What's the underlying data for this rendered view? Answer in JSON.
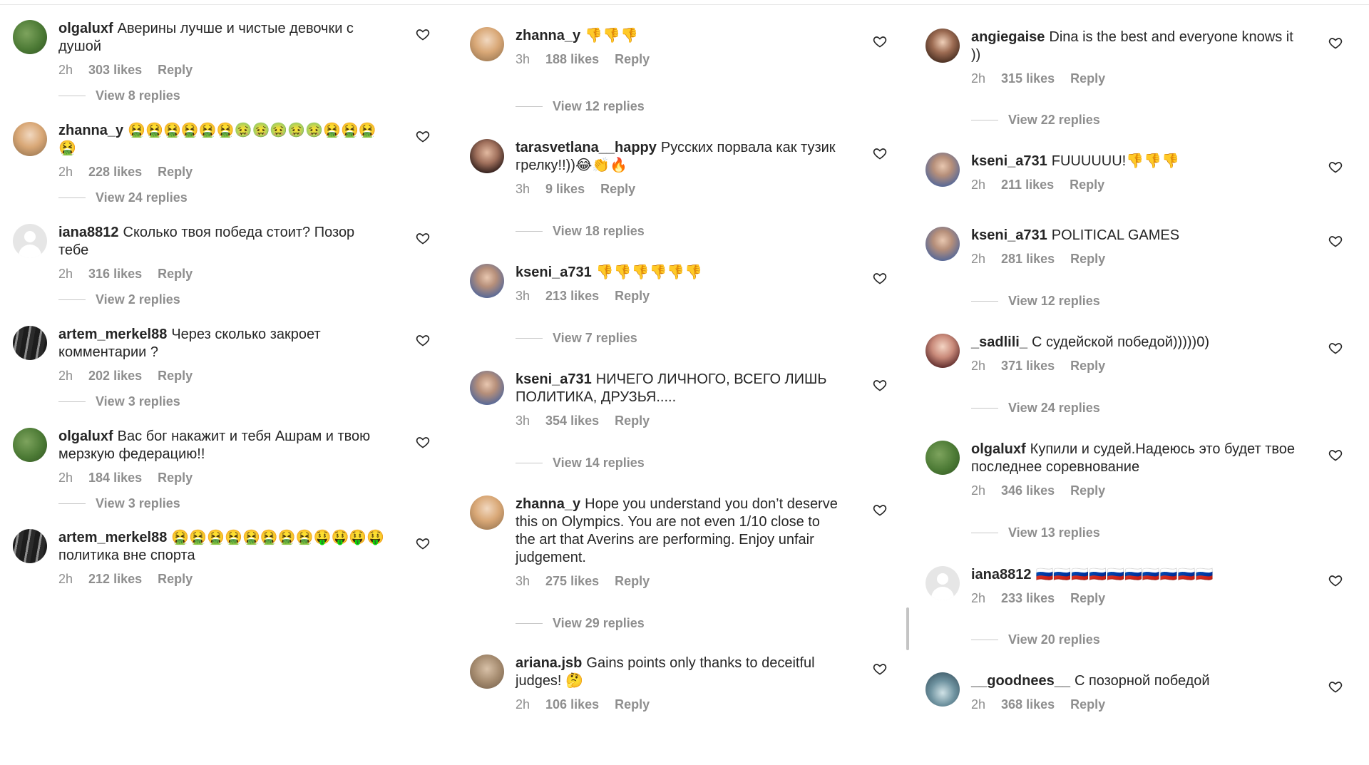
{
  "columns": [
    {
      "comments": [
        {
          "username": "olgaluxf",
          "text": "Аверины лучше и чистые девочки с душой",
          "time": "2h",
          "likes": "303 likes",
          "reply": "Reply",
          "view_replies": "View 8 replies",
          "avatar": "green"
        },
        {
          "username": "zhanna_y",
          "text": "🤮🤮🤮🤮🤮🤮🤢🤢🤢🤢🤢🤮🤮🤮🤮",
          "time": "2h",
          "likes": "228 likes",
          "reply": "Reply",
          "view_replies": "View 24 replies",
          "avatar": "blonde"
        },
        {
          "username": "iana8812",
          "text": "Сколько твоя победа стоит? Позор тебе",
          "time": "2h",
          "likes": "316 likes",
          "reply": "Reply",
          "view_replies": "View 2 replies",
          "avatar": "grey"
        },
        {
          "username": "artem_merkel88",
          "text": "Через сколько закроет комментарии ?",
          "time": "2h",
          "likes": "202 likes",
          "reply": "Reply",
          "view_replies": "View 3 replies",
          "avatar": "dark"
        },
        {
          "username": "olgaluxf",
          "text": "Вас бог накажит и тебя Ашрам и твою мерзкую федерацию!!",
          "time": "2h",
          "likes": "184 likes",
          "reply": "Reply",
          "view_replies": "View 3 replies",
          "avatar": "green"
        },
        {
          "username": "artem_merkel88",
          "text": "🤮🤮🤮🤮🤮🤮🤮🤮🤑🤑🤑🤑политика вне спорта",
          "time": "2h",
          "likes": "212 likes",
          "reply": "Reply",
          "view_replies": "",
          "avatar": "dark"
        }
      ]
    },
    {
      "comments": [
        {
          "username": "zhanna_y",
          "text": "👎👎👎",
          "time": "3h",
          "likes": "188 likes",
          "reply": "Reply",
          "view_replies": "View 12 replies",
          "avatar": "blonde"
        },
        {
          "username": "tarasvetlana__happy",
          "text": "Русских порвала как тузик грелку!!))😂👏🔥",
          "time": "3h",
          "likes": "9 likes",
          "reply": "Reply",
          "view_replies": "View 18 replies",
          "avatar": "face"
        },
        {
          "username": "kseni_a731",
          "text": "👎👎👎👎👎👎",
          "time": "3h",
          "likes": "213 likes",
          "reply": "Reply",
          "view_replies": "View 7 replies",
          "avatar": "purple"
        },
        {
          "username": "kseni_a731",
          "text": "НИЧЕГО ЛИЧНОГО, ВСЕГО ЛИШЬ ПОЛИТИКА, ДРУЗЬЯ.....",
          "time": "3h",
          "likes": "354 likes",
          "reply": "Reply",
          "view_replies": "View 14 replies",
          "avatar": "purple"
        },
        {
          "username": "zhanna_y",
          "text": "Hope you understand you don’t deserve this on Olympics. You are not even 1/10 close to the art that Averins are performing. Enjoy unfair judgement.",
          "time": "3h",
          "likes": "275 likes",
          "reply": "Reply",
          "view_replies": "View 29 replies",
          "avatar": "blonde"
        },
        {
          "username": "ariana.jsb",
          "text": "Gains points only thanks to deceitful judges! 🤔",
          "time": "2h",
          "likes": "106 likes",
          "reply": "Reply",
          "view_replies": "",
          "avatar": "tan"
        }
      ]
    },
    {
      "comments": [
        {
          "username": "angiegaise",
          "text": "Dina is the best and everyone knows it ))",
          "time": "2h",
          "likes": "315 likes",
          "reply": "Reply",
          "view_replies": "View 22 replies",
          "avatar": "brunette"
        },
        {
          "username": "kseni_a731",
          "text": "FUUUUUU!👎👎👎",
          "time": "2h",
          "likes": "211 likes",
          "reply": "Reply",
          "view_replies": "",
          "avatar": "purple"
        },
        {
          "username": "kseni_a731",
          "text": "POLITICAL GAMES",
          "time": "2h",
          "likes": "281 likes",
          "reply": "Reply",
          "view_replies": "View 12 replies",
          "avatar": "purple"
        },
        {
          "username": "_sadlili_",
          "text": "С судейской победой)))))0)",
          "time": "2h",
          "likes": "371 likes",
          "reply": "Reply",
          "view_replies": "View 24 replies",
          "avatar": "pink"
        },
        {
          "username": "olgaluxf",
          "text": "Купили и судей.Надеюсь это будет твое последнее соревнование",
          "time": "2h",
          "likes": "346 likes",
          "reply": "Reply",
          "view_replies": "View 13 replies",
          "avatar": "green"
        },
        {
          "username": "iana8812",
          "text": "🇷🇺🇷🇺🇷🇺🇷🇺🇷🇺🇷🇺🇷🇺🇷🇺🇷🇺🇷🇺",
          "time": "2h",
          "likes": "233 likes",
          "reply": "Reply",
          "view_replies": "View 20 replies",
          "avatar": "grey"
        },
        {
          "username": "__goodnees__",
          "text": "С позорной победой",
          "time": "2h",
          "likes": "368 likes",
          "reply": "Reply",
          "view_replies": "",
          "avatar": "teal"
        }
      ]
    }
  ],
  "icons": {
    "like": "heart-outline-icon"
  }
}
